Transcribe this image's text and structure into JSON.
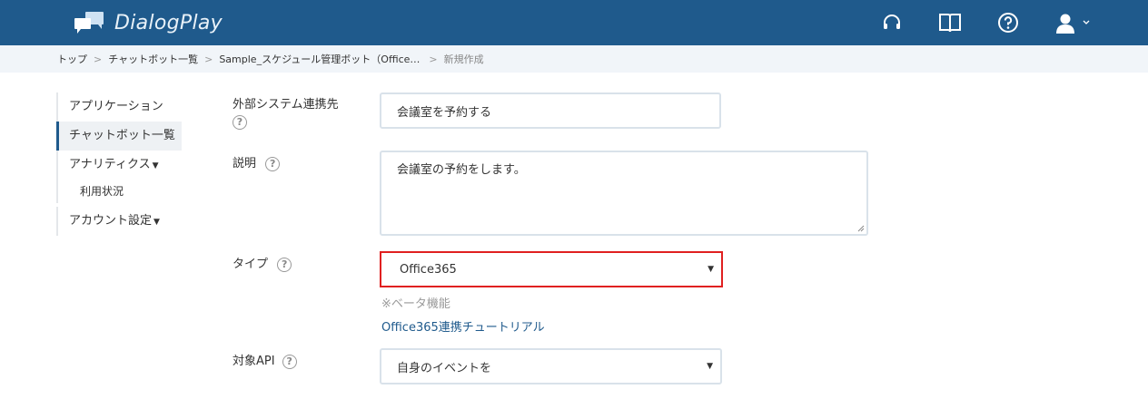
{
  "app": {
    "title": "DialogPlay",
    "header_icons": [
      "headset-icon",
      "book-icon",
      "help-icon",
      "user-icon"
    ]
  },
  "breadcrumb": {
    "items": [
      "トップ",
      "チャットボット一覧",
      "Sample_スケジュール管理ボット（Office…"
    ],
    "current": "新規作成"
  },
  "sidebar": {
    "items": [
      {
        "label": "アプリケーション"
      },
      {
        "label": "チャットボット一覧"
      },
      {
        "label": "アナリティクス"
      },
      {
        "label": "利用状況"
      },
      {
        "label": "アカウント設定"
      }
    ]
  },
  "form": {
    "external_system": {
      "label": "外部システム連携先",
      "value": "会議室を予約する"
    },
    "description": {
      "label": "説明",
      "value": "会議室の予約をします。"
    },
    "type": {
      "label": "タイプ",
      "selected": "Office365",
      "beta_note": "※ベータ機能",
      "tutorial_link": "Office365連携チュートリアル"
    },
    "target_api": {
      "label": "対象API",
      "selected": "自身のイベントを"
    }
  },
  "colors": {
    "header_bg": "#1f5a8c",
    "breadcrumb_bg": "#f1f5f9",
    "highlight_border": "#e02020",
    "link": "#1f5a8c"
  }
}
